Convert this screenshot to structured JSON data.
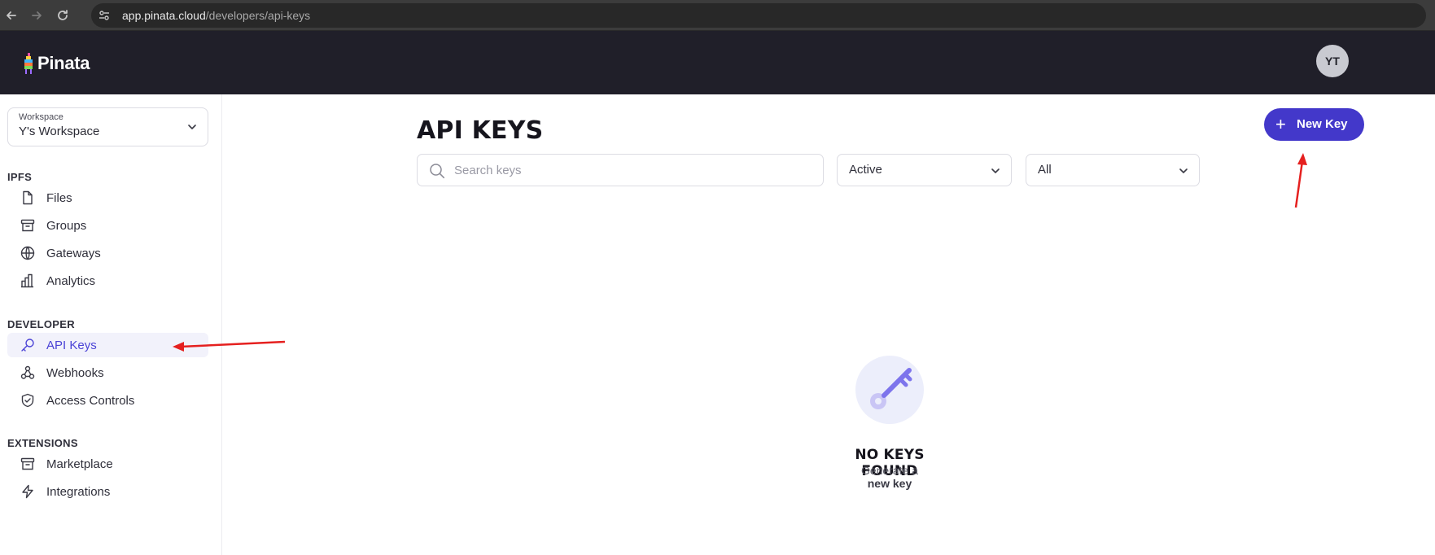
{
  "browser": {
    "url_host": "app.pinata.cloud",
    "url_path": "/developers/api-keys",
    "back_icon": "arrow-left-icon",
    "forward_icon": "arrow-right-icon",
    "reload_icon": "reload-icon"
  },
  "header": {
    "logo_text": "Pinata",
    "avatar_initials": "YT"
  },
  "sidebar": {
    "workspace_label": "Workspace",
    "workspace_value": "Y's Workspace",
    "sections": [
      {
        "title": "IPFS",
        "items": [
          {
            "label": "Files",
            "icon": "file-icon"
          },
          {
            "label": "Groups",
            "icon": "archive-icon"
          },
          {
            "label": "Gateways",
            "icon": "globe-icon"
          },
          {
            "label": "Analytics",
            "icon": "bar-chart-icon"
          }
        ]
      },
      {
        "title": "DEVELOPER",
        "items": [
          {
            "label": "API Keys",
            "icon": "key-icon",
            "active": true
          },
          {
            "label": "Webhooks",
            "icon": "webhook-icon"
          },
          {
            "label": "Access Controls",
            "icon": "shield-check-icon"
          }
        ]
      },
      {
        "title": "EXTENSIONS",
        "items": [
          {
            "label": "Marketplace",
            "icon": "store-icon"
          },
          {
            "label": "Integrations",
            "icon": "zap-icon"
          }
        ]
      }
    ]
  },
  "main": {
    "title": "API KEYS",
    "new_key_label": "New Key",
    "search_placeholder": "Search keys",
    "status_filter": "Active",
    "scope_filter": "All",
    "empty_title": "NO KEYS FOUND",
    "empty_sub": "Generate a",
    "empty_link": "new key"
  },
  "colors": {
    "accent": "#4338ca",
    "header_bg": "#201f29",
    "active_text": "#4b43d6",
    "annotation_arrow": "#e5201f"
  }
}
